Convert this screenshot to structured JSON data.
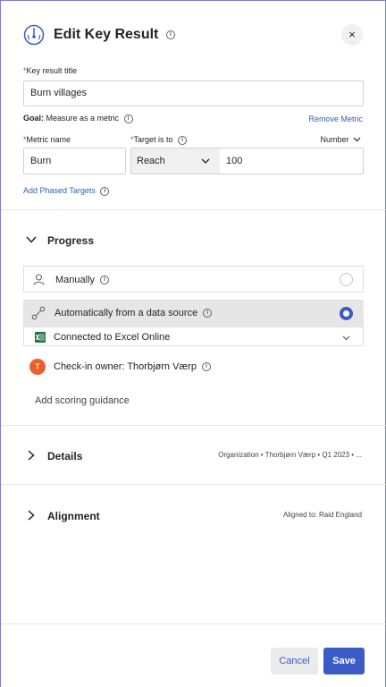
{
  "header": {
    "title": "Edit Key Result",
    "close": "×"
  },
  "key_result": {
    "label": "Key result title",
    "required": "*",
    "value": "Burn villages"
  },
  "goal": {
    "prefix": "Goal:",
    "value": "Measure as a metric",
    "remove_link": "Remove Metric"
  },
  "metric": {
    "name_label": "Metric name",
    "name_value": "Burn",
    "target_label": "Target is to",
    "target_option": "Reach",
    "target_value": "100",
    "unit": "Number"
  },
  "phased_link": "Add Phased Targets",
  "progress": {
    "title": "Progress",
    "manual_label": "Manually",
    "auto_label": "Automatically from a data source",
    "connected_label": "Connected to Excel Online",
    "owner_initial": "T",
    "owner_label": "Check-in owner: Thorbjørn Værp",
    "scoring_link": "Add scoring guidance"
  },
  "details": {
    "title": "Details",
    "summary": "Organization • Thorbjørn Værp • Q1 2023 • ..."
  },
  "alignment": {
    "title": "Alignment",
    "summary": "Aligned to: Raid England"
  },
  "footer": {
    "cancel": "Cancel",
    "save": "Save"
  },
  "colors": {
    "accent": "#3b5cc6",
    "avatar": "#e8612c",
    "excel": "#1e7145",
    "link": "#2f5fb0",
    "required": "#c4314b"
  }
}
